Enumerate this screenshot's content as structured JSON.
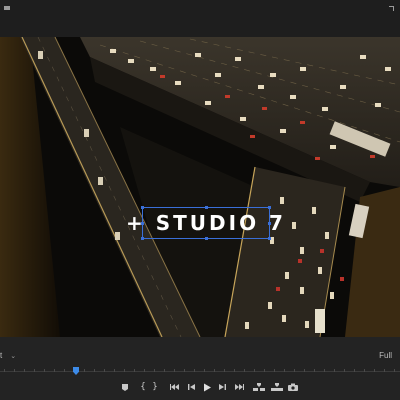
{
  "viewer": {
    "title_overlay": "+ STUDIO 7"
  },
  "controls": {
    "fit_value": "t",
    "resolution_value": "Full",
    "playhead_fraction": 0.19
  },
  "transport": {
    "buttons": [
      {
        "name": "add-marker-button",
        "icon": "marker-icon"
      },
      {
        "name": "mark-in-button",
        "icon": "mark-in-icon",
        "glyph": "{"
      },
      {
        "name": "mark-out-button",
        "icon": "mark-out-icon",
        "glyph": "}"
      },
      {
        "name": "go-to-in-button",
        "icon": "go-to-in-icon"
      },
      {
        "name": "step-back-button",
        "icon": "step-back-icon"
      },
      {
        "name": "play-button",
        "icon": "play-icon"
      },
      {
        "name": "step-forward-button",
        "icon": "step-forward-icon"
      },
      {
        "name": "go-to-out-button",
        "icon": "go-to-out-icon"
      },
      {
        "name": "insert-button",
        "icon": "insert-icon"
      },
      {
        "name": "overwrite-button",
        "icon": "overwrite-icon"
      },
      {
        "name": "export-frame-button",
        "icon": "camera-icon"
      }
    ]
  },
  "colors": {
    "selection": "#3a6fd8",
    "playhead": "#3d8be8",
    "panel_bg": "#232323"
  }
}
